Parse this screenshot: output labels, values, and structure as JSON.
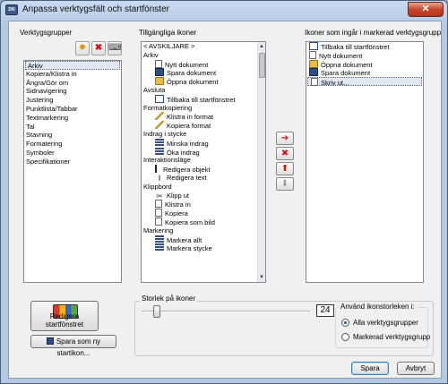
{
  "window": {
    "title": "Anpassa verktygsfält och startfönster",
    "close_label": "✕"
  },
  "groups": {
    "label": "Verktygsgrupper",
    "items": [
      "Arkiv",
      "Kopiera/Klistra in",
      "Ångra/Gör om",
      "Sidnavigering",
      "Justering",
      "Punktlista/Tabbar",
      "Textmarkering",
      "Tal",
      "Stavning",
      "Formatering",
      "Symboler",
      "Specifikationer"
    ],
    "selected_index": 0
  },
  "available": {
    "label": "Tillgängliga ikoner",
    "rows": [
      {
        "type": "header",
        "text": "< AVSKILJARE >"
      },
      {
        "type": "header",
        "text": "Arkiv"
      },
      {
        "type": "item",
        "icon": "doc",
        "text": "Nytt dokument"
      },
      {
        "type": "item",
        "icon": "save",
        "text": "Spara dokument"
      },
      {
        "type": "item",
        "icon": "folder",
        "text": "Öppna dokument"
      },
      {
        "type": "header",
        "text": "Avsluta"
      },
      {
        "type": "item",
        "icon": "back",
        "text": "Tillbaka till startfönstret"
      },
      {
        "type": "header",
        "text": "Formatkopiering"
      },
      {
        "type": "item",
        "icon": "edit",
        "text": "Klistra in format"
      },
      {
        "type": "item",
        "icon": "edit",
        "text": "Kopiera format"
      },
      {
        "type": "header",
        "text": "Indrag i stycke"
      },
      {
        "type": "item",
        "icon": "list",
        "text": "Minska indrag"
      },
      {
        "type": "item",
        "icon": "list",
        "text": "Öka indrag"
      },
      {
        "type": "header",
        "text": "Interaktionsläge"
      },
      {
        "type": "item",
        "icon": "cursor",
        "text": "Redigera objekt"
      },
      {
        "type": "item",
        "icon": "text",
        "text": "Redigera text"
      },
      {
        "type": "header",
        "text": "Klippbord"
      },
      {
        "type": "item",
        "icon": "cut",
        "text": "Klipp ut"
      },
      {
        "type": "item",
        "icon": "doc",
        "text": "Klistra in"
      },
      {
        "type": "item",
        "icon": "doc",
        "text": "Kopiera"
      },
      {
        "type": "item",
        "icon": "doc",
        "text": "Kopiera som bild"
      },
      {
        "type": "header",
        "text": "Markering"
      },
      {
        "type": "item",
        "icon": "list",
        "text": "Markera allt"
      },
      {
        "type": "item",
        "icon": "list",
        "text": "Markera stycke"
      }
    ]
  },
  "included": {
    "label": "Ikoner som ingår i markerad verktygsgrupp",
    "rows": [
      {
        "icon": "back",
        "text": "Tillbaka till startfönstret"
      },
      {
        "icon": "doc",
        "text": "Nytt dokument"
      },
      {
        "icon": "folder",
        "text": "Öppna dokument"
      },
      {
        "icon": "save",
        "text": "Spara dokument"
      },
      {
        "icon": "doc",
        "text": "Skriv ut..."
      }
    ],
    "selected_index": 4
  },
  "move_buttons": {
    "add": "➔",
    "remove": "✖",
    "up": "⬆",
    "down": "⬇"
  },
  "icon_size": {
    "label": "Storlek på ikoner",
    "value": "24"
  },
  "apply_scope": {
    "label": "Använd ikonstorleken i:",
    "options": [
      "Alla verktygsgrupper",
      "Markerad verktygsgrupp"
    ],
    "selected_index": 0
  },
  "start_window": {
    "edit_label": "Redigera startfönstret",
    "save_new_label": "Spara som ny startikon..."
  },
  "footer": {
    "save_label": "Spara",
    "cancel_label": "Avbryt"
  },
  "colors": {
    "accent": "#3c7fb1",
    "remove_red": "#d11111"
  }
}
